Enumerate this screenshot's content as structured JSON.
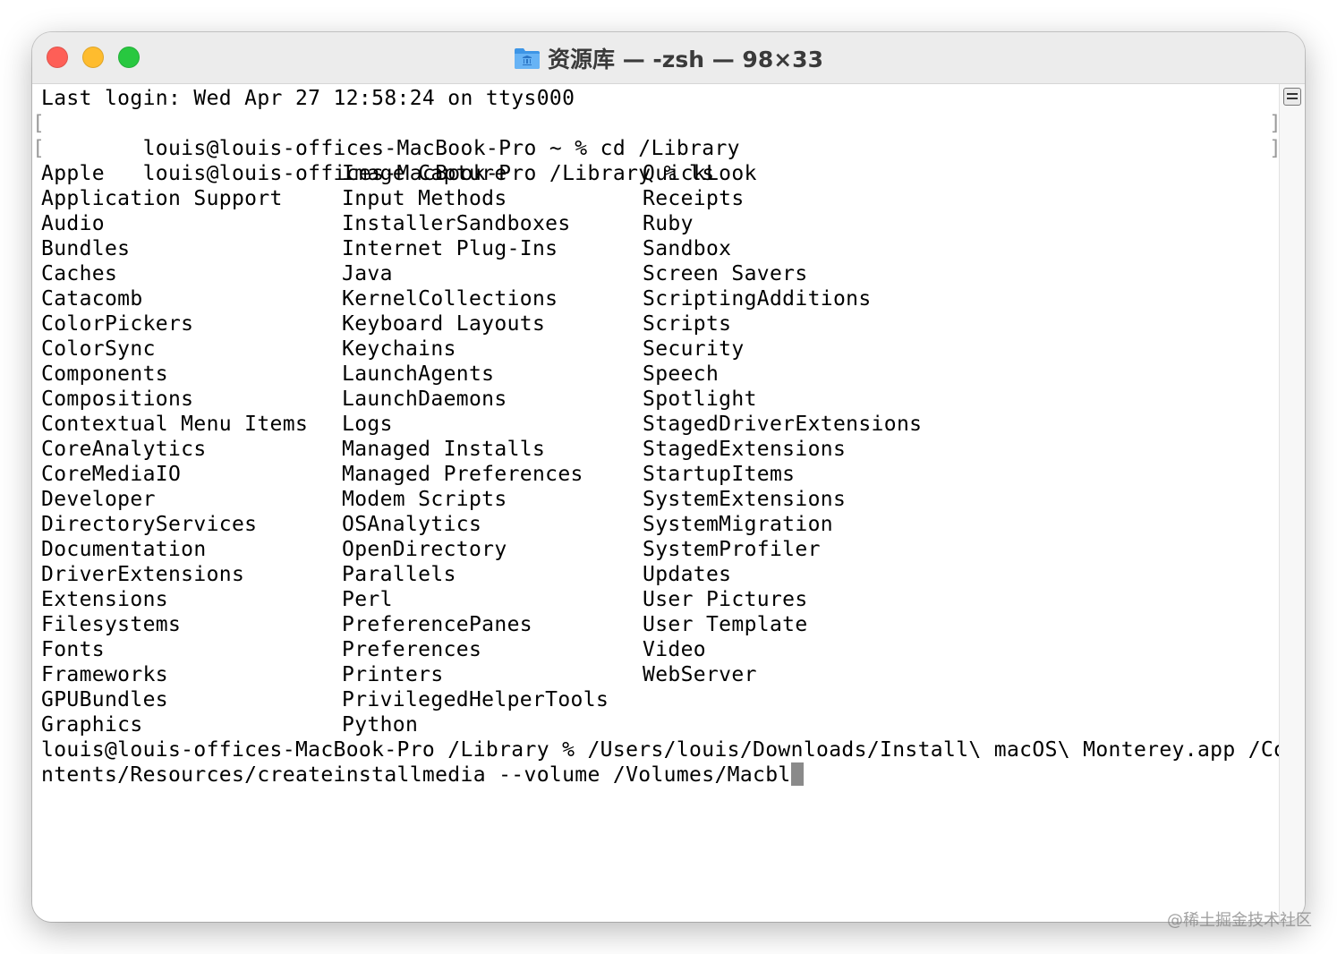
{
  "window": {
    "title": "资源库 — -zsh — 98×33",
    "icons": {
      "folder": "folder-icon"
    },
    "traffic_lights": {
      "close": "#fe5f57",
      "minimize": "#febc2e",
      "maximize": "#28c840"
    }
  },
  "terminal": {
    "last_login": "Last login: Wed Apr 27 12:58:24 on ttys000",
    "cmd1": "louis@louis-offices-MacBook-Pro ~ % cd /Library",
    "cmd2": "louis@louis-offices-MacBook-Pro /Library % ls",
    "bracket_left": "[",
    "bracket_right": "]",
    "ls_columns": [
      [
        "Apple",
        "Application Support",
        "Audio",
        "Bundles",
        "Caches",
        "Catacomb",
        "ColorPickers",
        "ColorSync",
        "Components",
        "Compositions",
        "Contextual Menu Items",
        "CoreAnalytics",
        "CoreMediaIO",
        "Developer",
        "DirectoryServices",
        "Documentation",
        "DriverExtensions",
        "Extensions",
        "Filesystems",
        "Fonts",
        "Frameworks",
        "GPUBundles",
        "Graphics"
      ],
      [
        "Image Capture",
        "Input Methods",
        "InstallerSandboxes",
        "Internet Plug-Ins",
        "Java",
        "KernelCollections",
        "Keyboard Layouts",
        "Keychains",
        "LaunchAgents",
        "LaunchDaemons",
        "Logs",
        "Managed Installs",
        "Managed Preferences",
        "Modem Scripts",
        "OSAnalytics",
        "OpenDirectory",
        "Parallels",
        "Perl",
        "PreferencePanes",
        "Preferences",
        "Printers",
        "PrivilegedHelperTools",
        "Python"
      ],
      [
        "QuickLook",
        "Receipts",
        "Ruby",
        "Sandbox",
        "Screen Savers",
        "ScriptingAdditions",
        "Scripts",
        "Security",
        "Speech",
        "Spotlight",
        "StagedDriverExtensions",
        "StagedExtensions",
        "StartupItems",
        "SystemExtensions",
        "SystemMigration",
        "SystemProfiler",
        "Updates",
        "User Pictures",
        "User Template",
        "Video",
        "WebServer"
      ]
    ],
    "cmd3_line1": "louis@louis-offices-MacBook-Pro /Library % /Users/louis/Downloads/Install\\ macOS\\ Monterey.app /Co",
    "cmd3_line2": "ntents/Resources/createinstallmedia --volume /Volumes/Macbl"
  },
  "watermark": "@稀土掘金技术社区"
}
